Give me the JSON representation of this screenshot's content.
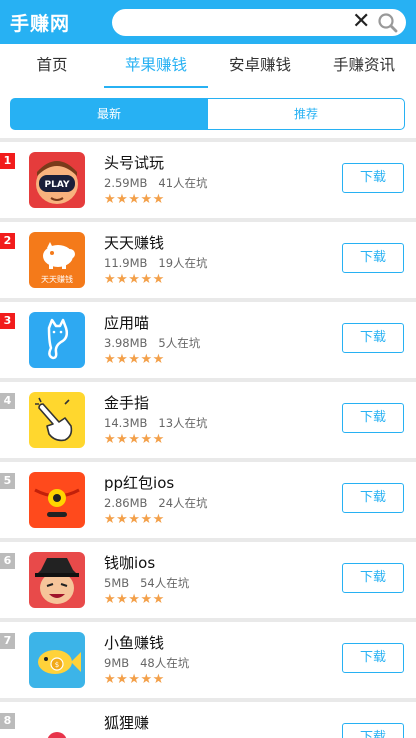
{
  "header": {
    "logo": "手赚网",
    "search_placeholder": "",
    "search_value": ""
  },
  "tabs": [
    "首页",
    "苹果赚钱",
    "安卓赚钱",
    "手赚资讯"
  ],
  "segments": {
    "left": "最新",
    "right": "推荐"
  },
  "download_label": "下载",
  "apps": [
    {
      "rank": "1",
      "name": "头号试玩",
      "size": "2.59MB",
      "players": "41人在坑",
      "stars": "★★★★★",
      "icon": "play-icon"
    },
    {
      "rank": "2",
      "name": "天天赚钱",
      "size": "11.9MB",
      "players": "19人在坑",
      "stars": "★★★★★",
      "icon": "piggy-bank-icon",
      "icon_caption": "天天赚钱"
    },
    {
      "rank": "3",
      "name": "应用喵",
      "size": "3.98MB",
      "players": "5人在坑",
      "stars": "★★★★★",
      "icon": "cat-icon"
    },
    {
      "rank": "4",
      "name": "金手指",
      "size": "14.3MB",
      "players": "13人在坑",
      "stars": "★★★★★",
      "icon": "pointing-hand-icon"
    },
    {
      "rank": "5",
      "name": "pp红包ios",
      "size": "2.86MB",
      "players": "24人在坑",
      "stars": "★★★★★",
      "icon": "red-envelope-icon"
    },
    {
      "rank": "6",
      "name": "钱咖ios",
      "size": "5MB",
      "players": "54人在坑",
      "stars": "★★★★★",
      "icon": "character-face-icon"
    },
    {
      "rank": "7",
      "name": "小鱼赚钱",
      "size": "9MB",
      "players": "48人在坑",
      "stars": "★★★★★",
      "icon": "fish-icon"
    },
    {
      "rank": "8",
      "name": "狐狸赚",
      "size": "",
      "players": "",
      "stars": "",
      "icon": "fox-icon"
    }
  ],
  "colors": {
    "brand": "#27b1f3",
    "rank_top": "#f21c1c",
    "rank_rest": "#bbbbbb",
    "star": "#f3a04a"
  }
}
